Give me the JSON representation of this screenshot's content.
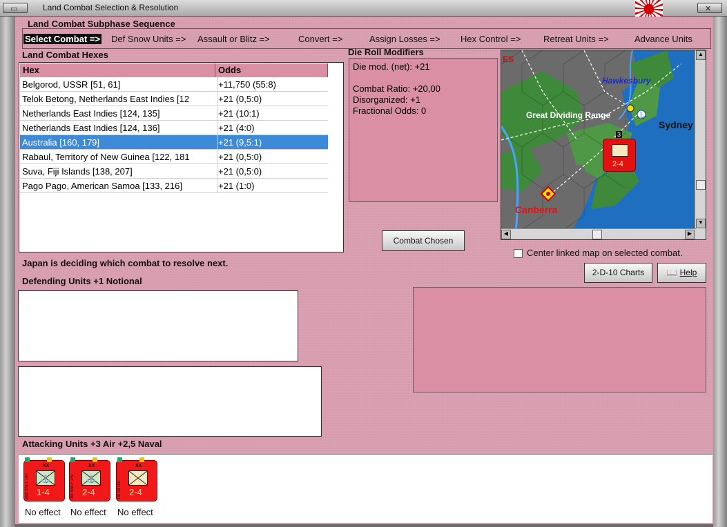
{
  "window": {
    "title": "Land Combat Selection & Resolution"
  },
  "sequence": {
    "heading": "Land Combat Subphase Sequence",
    "items": [
      {
        "label": "Select Combat =>",
        "active": true
      },
      {
        "label": "Def Snow Units =>"
      },
      {
        "label": "Assault or Blitz =>"
      },
      {
        "label": "Convert =>"
      },
      {
        "label": "Assign Losses =>"
      },
      {
        "label": "Hex Control =>"
      },
      {
        "label": "Retreat Units =>"
      },
      {
        "label": "Advance Units"
      }
    ]
  },
  "hexes": {
    "heading": "Land Combat Hexes",
    "columns": [
      "Hex",
      "Odds"
    ],
    "rows": [
      {
        "hex": "Belgorod, USSR [51, 61]",
        "odds": "+11,750 (55:8)"
      },
      {
        "hex": "Telok Betong, Netherlands East Indies [12",
        "odds": "+21 (0,5:0)"
      },
      {
        "hex": "Netherlands East Indies [124, 135]",
        "odds": "+21 (10:1)"
      },
      {
        "hex": "Netherlands East Indies [124, 136]",
        "odds": "+21 (4:0)"
      },
      {
        "hex": "Australia [160, 179]",
        "odds": "+21 (9,5:1)",
        "selected": true
      },
      {
        "hex": "Rabaul, Territory of New Guinea [122, 181",
        "odds": "+21 (0,5:0)"
      },
      {
        "hex": "Suva, Fiji Islands [138, 207]",
        "odds": "+21 (0,5:0)"
      },
      {
        "hex": "Pago Pago, American Samoa [133, 216]",
        "odds": "+21 (1:0)"
      }
    ]
  },
  "modifiers": {
    "heading": "Die Roll Modifiers",
    "lines": [
      "Die mod. (net): +21",
      "",
      "Combat Ratio: +20,00",
      "Disorganized: +1",
      "Fractional Odds: 0"
    ]
  },
  "buttons": {
    "combat_chosen": "Combat Chosen",
    "charts": "2-D-10 Charts",
    "help": "Help"
  },
  "map": {
    "labels": {
      "region": "Great Dividing Range",
      "city1": "Hawkesbury",
      "city2": "Sydney",
      "city3": "Canberra",
      "corner": "ES",
      "stack_count": "3",
      "unit_strength": "2-4"
    },
    "colors": {
      "sea": "#1f6fc0",
      "forest": "#3e8a3a",
      "mountain": "#6b6b6b",
      "accent": "#e31212"
    }
  },
  "center_option": {
    "label": "Center linked map on selected combat.",
    "checked": false
  },
  "status": "Japan is deciding which combat to resolve next.",
  "defending": {
    "heading": "Defending Units +1 Notional"
  },
  "attacking": {
    "heading": "Attacking Units +3 Air +2,5 Naval",
    "units": [
      {
        "size": "XX",
        "strength": "1-4",
        "name": "2nd SNLF Div",
        "effect": "No effect",
        "icon": "anchor-infantry"
      },
      {
        "size": "XX",
        "strength": "2-4",
        "name": "3rd SNLF Div",
        "effect": "No effect",
        "icon": "anchor-infantry"
      },
      {
        "size": "XX",
        "strength": "2-4",
        "name": "1st Inf Div",
        "effect": "No effect",
        "icon": "infantry"
      }
    ]
  }
}
